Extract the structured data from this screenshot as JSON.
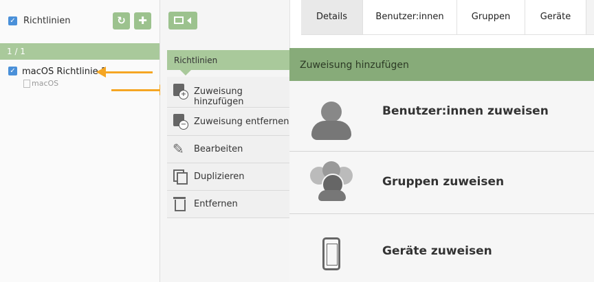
{
  "left": {
    "header_label": "Richtlinien",
    "counter": "1 / 1",
    "policy": {
      "name": "macOS Richtlinie 1",
      "platform": "macOS"
    }
  },
  "middle": {
    "section_title": "Richtlinien",
    "actions": [
      {
        "label": "Zuweisung hinzufügen",
        "icon": "assignment-add-icon"
      },
      {
        "label": "Zuweisung entfernen",
        "icon": "assignment-remove-icon"
      },
      {
        "label": "Bearbeiten",
        "icon": "pencil-icon"
      },
      {
        "label": "Duplizieren",
        "icon": "duplicate-icon"
      },
      {
        "label": "Entfernen",
        "icon": "trash-icon"
      }
    ]
  },
  "tabs": [
    "Details",
    "Benutzer:innen",
    "Gruppen",
    "Geräte"
  ],
  "panel": {
    "title": "Zuweisung hinzufügen",
    "options": [
      {
        "label": "Benutzer:innen zuweisen",
        "icon": "user-icon"
      },
      {
        "label": "Gruppen zuweisen",
        "icon": "group-icon"
      },
      {
        "label": "Geräte zuweisen",
        "icon": "phone-icon"
      }
    ]
  },
  "colors": {
    "accent_green": "#87ab79",
    "arrow_orange": "#f5a623",
    "checkbox_blue": "#4a90d9"
  }
}
